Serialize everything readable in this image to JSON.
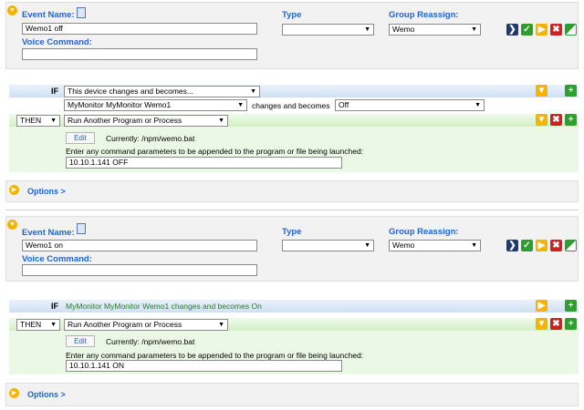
{
  "events": [
    {
      "labels": {
        "event_name": "Event Name:",
        "type": "Type",
        "group_reassign": "Group Reassign:",
        "voice_command": "Voice Command:"
      },
      "event_name_value": "Wemo1 off",
      "type_value": "",
      "group_value": "Wemo",
      "voice_command_value": "",
      "if_keyword": "IF",
      "if_condition": "This device changes and becomes...",
      "device": "MyMonitor MyMonitor Wemo1",
      "changes_text": "changes and becomes",
      "state": "Off",
      "then_keyword": "THEN",
      "action": "Run Another Program or Process",
      "edit_label": "Edit",
      "currently": "Currently: /npm/wemo.bat",
      "param_instructions": "Enter any command parameters to be appended to the program or file being launched:",
      "param_value": "10.10.1.141 OFF",
      "options": "Options >"
    },
    {
      "labels": {
        "event_name": "Event Name:",
        "type": "Type",
        "group_reassign": "Group Reassign:",
        "voice_command": "Voice Command:"
      },
      "event_name_value": "Wemo1 on",
      "type_value": "",
      "group_value": "Wemo",
      "voice_command_value": "",
      "if_keyword": "IF",
      "if_summary": "MyMonitor MyMonitor Wemo1 changes and becomes On",
      "then_keyword": "THEN",
      "action": "Run Another Program or Process",
      "edit_label": "Edit",
      "currently": "Currently: /npm/wemo.bat",
      "param_instructions": "Enter any command parameters to be appended to the program or file being launched:",
      "param_value": "10.10.1.141 ON",
      "options": "Options >"
    }
  ],
  "icons": {
    "collapse": "collapse-circle-icon",
    "notes": "notes-icon",
    "run": "run-icon",
    "save": "check-icon",
    "play": "play-icon",
    "delete": "delete-icon",
    "copy": "copy-icon",
    "add": "add-icon"
  },
  "colors": {
    "label_blue": "#2266cc",
    "if_bar": "#cfe0f3",
    "then_bar": "#d3efc7",
    "accent_yellow": "#f4b400",
    "delete_red": "#cc2222",
    "add_green": "#2f9e2f"
  }
}
